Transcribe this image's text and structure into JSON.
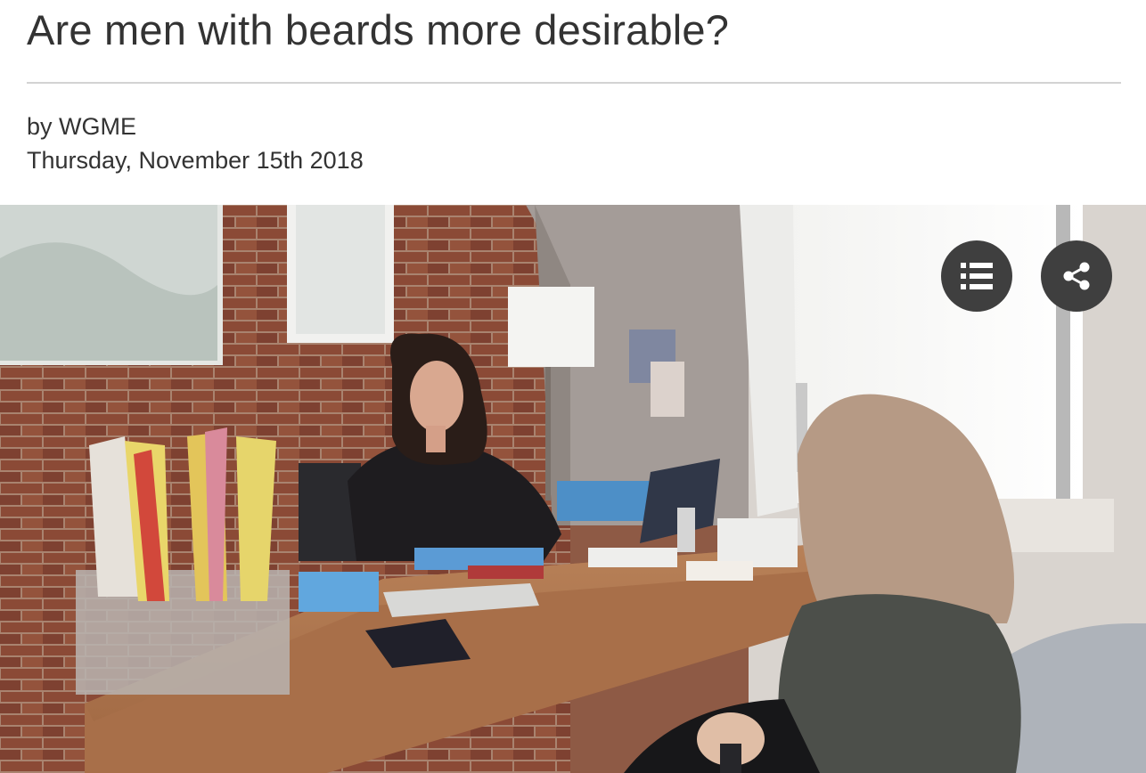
{
  "article": {
    "headline": "Are men with beards more desirable?",
    "byline": "by WGME",
    "date": "Thursday, November 15th 2018"
  },
  "media": {
    "buttons": [
      {
        "name": "list-button",
        "icon": "list-icon"
      },
      {
        "name": "share-button",
        "icon": "share-icon"
      }
    ],
    "colors": {
      "button_bg": "#3f3f3f",
      "icon": "#ffffff"
    }
  }
}
